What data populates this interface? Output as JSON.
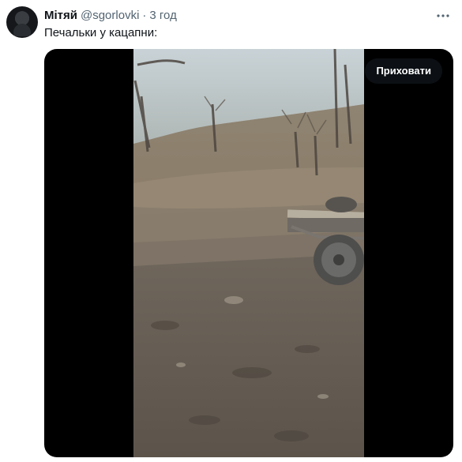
{
  "author": {
    "name": "Мітяй",
    "handle": "@sgorlovki",
    "separator": "·",
    "time": "3 год"
  },
  "tweet": {
    "text": "Печальки у кацапни:"
  },
  "media": {
    "hide_button_label": "Приховати"
  },
  "icons": {
    "menu": "more-horizontal-icon"
  }
}
